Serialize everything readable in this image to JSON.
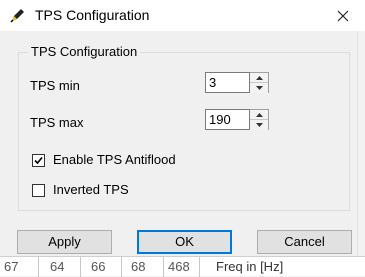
{
  "window": {
    "title": "TPS Configuration",
    "app_icon": "pencil-icon",
    "close_icon": "close-icon"
  },
  "group": {
    "title": "TPS Configuration"
  },
  "fields": {
    "tps_min": {
      "label": "TPS  min",
      "value": "3"
    },
    "tps_max": {
      "label": "TPS max",
      "value": "190"
    }
  },
  "checkboxes": {
    "antiflood": {
      "label": "Enable TPS Antiflood",
      "checked": true
    },
    "inverted": {
      "label": "Inverted TPS",
      "checked": false
    }
  },
  "buttons": {
    "apply": "Apply",
    "ok": "OK",
    "cancel": "Cancel"
  },
  "background_window": {
    "cells": [
      "67",
      "64",
      "66",
      "68",
      "468",
      "Freq in [Hz]"
    ]
  },
  "colors": {
    "accent": "#0078d7",
    "window_bg": "#f0f0f0"
  }
}
